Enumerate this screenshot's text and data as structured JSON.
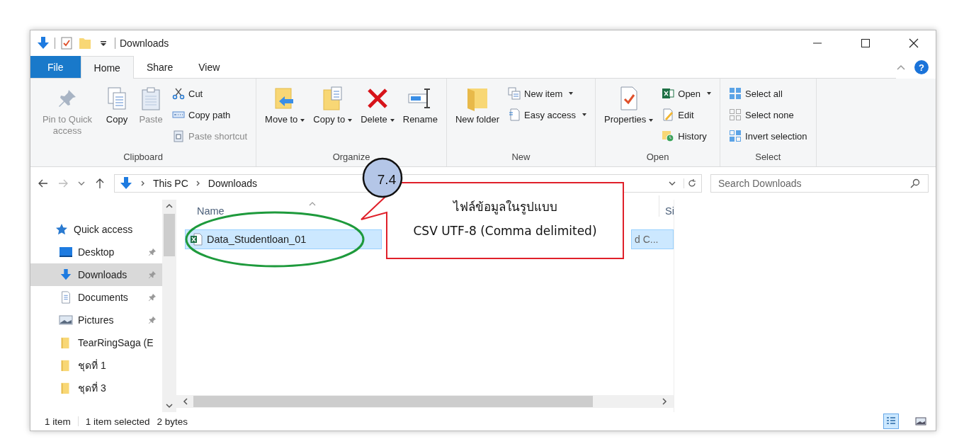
{
  "window": {
    "title": "Downloads"
  },
  "ribbon_tabs": [
    {
      "label": "File",
      "kind": "file",
      "selected": false
    },
    {
      "label": "Home",
      "kind": "tab",
      "selected": true
    },
    {
      "label": "Share",
      "kind": "tab",
      "selected": false
    },
    {
      "label": "View",
      "kind": "tab",
      "selected": false
    }
  ],
  "help": {
    "label": "?"
  },
  "ribbon_groups": [
    {
      "label": "Clipboard",
      "columns": [
        {
          "kind": "large",
          "label": "Pin to Quick access",
          "disabled": true,
          "dropdown": false
        },
        {
          "kind": "large",
          "label": "Copy",
          "disabled": false,
          "dropdown": false
        },
        {
          "kind": "large",
          "label": "Paste",
          "disabled": true,
          "dropdown": false
        },
        {
          "kind": "stack",
          "items": [
            {
              "label": "Cut",
              "disabled": false,
              "dropdown": false
            },
            {
              "label": "Copy path",
              "disabled": false,
              "dropdown": false
            },
            {
              "label": "Paste shortcut",
              "disabled": true,
              "dropdown": false
            }
          ]
        }
      ]
    },
    {
      "label": "Organize",
      "columns": [
        {
          "kind": "large",
          "label": "Move to",
          "disabled": false,
          "dropdown": true
        },
        {
          "kind": "large",
          "label": "Copy to",
          "disabled": false,
          "dropdown": true
        },
        {
          "kind": "large",
          "label": "Delete",
          "disabled": false,
          "dropdown": true
        },
        {
          "kind": "large",
          "label": "Rename",
          "disabled": false,
          "dropdown": false
        }
      ]
    },
    {
      "label": "New",
      "columns": [
        {
          "kind": "large",
          "label": "New folder",
          "disabled": false,
          "dropdown": false
        },
        {
          "kind": "stack",
          "items": [
            {
              "label": "New item",
              "disabled": false,
              "dropdown": true
            },
            {
              "label": "Easy access",
              "disabled": false,
              "dropdown": true
            }
          ]
        }
      ]
    },
    {
      "label": "Open",
      "columns": [
        {
          "kind": "large",
          "label": "Properties",
          "disabled": false,
          "dropdown": true
        },
        {
          "kind": "stack",
          "items": [
            {
              "label": "Open",
              "disabled": false,
              "dropdown": true
            },
            {
              "label": "Edit",
              "disabled": false,
              "dropdown": false
            },
            {
              "label": "History",
              "disabled": false,
              "dropdown": false
            }
          ]
        }
      ]
    },
    {
      "label": "Select",
      "columns": [
        {
          "kind": "stack",
          "items": [
            {
              "label": "Select all",
              "disabled": false,
              "dropdown": false
            },
            {
              "label": "Select none",
              "disabled": false,
              "dropdown": false
            },
            {
              "label": "Invert selection",
              "disabled": false,
              "dropdown": false
            }
          ]
        }
      ]
    }
  ],
  "address": {
    "path": [
      "This PC",
      "Downloads"
    ]
  },
  "search": {
    "placeholder": "Search Downloads"
  },
  "navigation": [
    {
      "label": "Quick access",
      "selected": false,
      "children": [
        {
          "label": "Desktop",
          "pinned": true,
          "selected": false
        },
        {
          "label": "Downloads",
          "pinned": true,
          "selected": true
        },
        {
          "label": "Documents",
          "pinned": true,
          "selected": false
        },
        {
          "label": "Pictures",
          "pinned": true,
          "selected": false
        },
        {
          "label": "TearRingSaga (E",
          "pinned": false,
          "selected": false
        },
        {
          "label": "ชุดที่ 1",
          "pinned": false,
          "selected": false
        },
        {
          "label": "ชุดที่ 3",
          "pinned": false,
          "selected": false
        }
      ]
    }
  ],
  "file_list": {
    "columns": [
      "Name",
      "Si"
    ],
    "rows": [
      {
        "name": "Data_Studentloan_01",
        "column_3": "d C...",
        "selected": true
      }
    ]
  },
  "status_bar": {
    "count": "1 item",
    "selection": "1 item selected",
    "size": "2 bytes"
  },
  "view_buttons": [
    {
      "kind": "details",
      "selected": true
    },
    {
      "kind": "large_icons",
      "selected": false
    }
  ],
  "annotation": {
    "step": "7.4",
    "callout": [
      "ไฟล์ข้อมูลในรูปแบบ",
      "CSV UTF-8 (Comma delimited)"
    ]
  }
}
